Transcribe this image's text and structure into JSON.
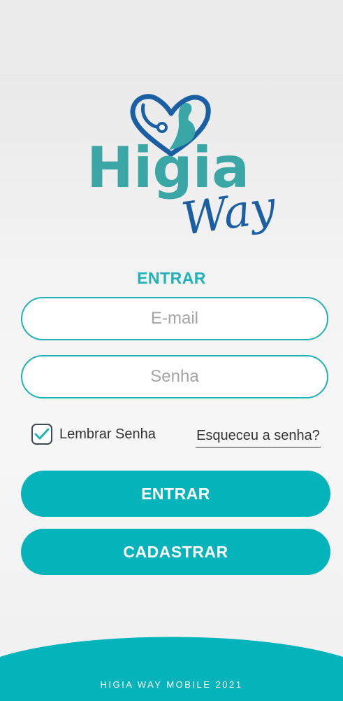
{
  "brand": {
    "name": "Higia",
    "tagline": "Way",
    "logo_icon": "heart-stethoscope-pregnant-icon",
    "primary_color": "#05b4bb",
    "logo_teal": "#3aa6a6",
    "logo_blue": "#1a5fa3"
  },
  "login": {
    "title": "ENTRAR",
    "email_placeholder": "E-mail",
    "password_placeholder": "Senha",
    "remember_label": "Lembrar Senha",
    "remember_checked": true,
    "forgot_label": "Esqueceu a senha?",
    "login_button": "ENTRAR",
    "register_button": "CADASTRAR"
  },
  "footer": {
    "text": "HIGIA WAY MOBILE 2021"
  }
}
